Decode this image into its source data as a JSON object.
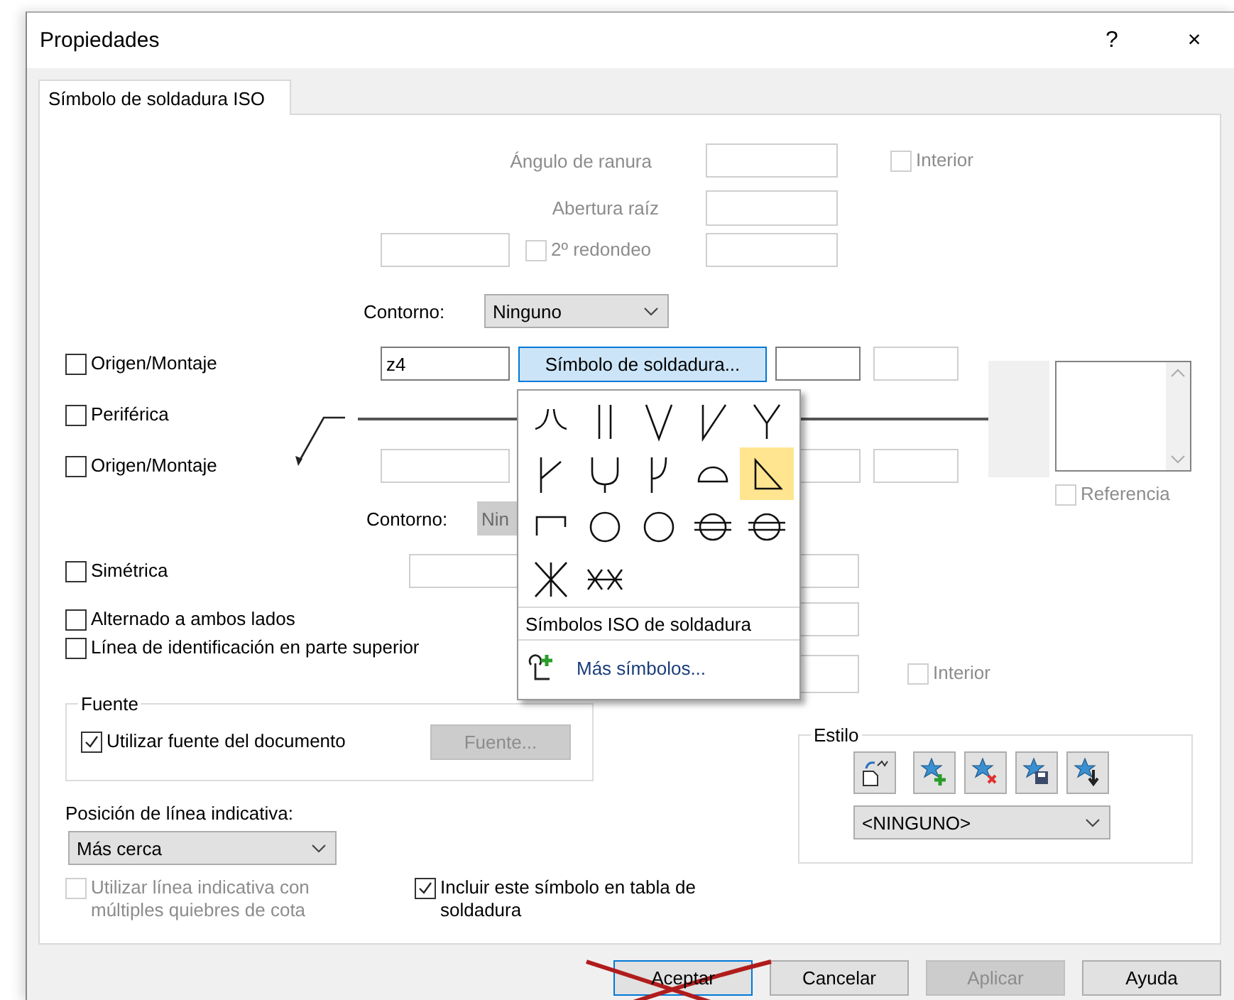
{
  "window": {
    "title": "Propiedades",
    "help": "?",
    "close": "×"
  },
  "tabs": [
    {
      "label": "Símbolo de soldadura ISO",
      "selected": true
    }
  ],
  "groove_angle": {
    "label": "Ángulo de ranura"
  },
  "root_opening": {
    "label": "Abertura raíz"
  },
  "inside_upper": {
    "label": "Interior",
    "checked": false,
    "disabled": true
  },
  "second_round": {
    "label": "2º redondeo",
    "checked": false,
    "disabled": true
  },
  "contour_upper": {
    "label": "Contorno:",
    "value": "Ninguno",
    "disabled": false
  },
  "origin_upper": {
    "label": "Origen/Montaje",
    "checked": false,
    "disabled": false
  },
  "size_value": "z4",
  "symbol_button": {
    "label": "Símbolo de soldadura...",
    "pressed": true
  },
  "all_around": {
    "label": "Periférica",
    "checked": false,
    "disabled": false
  },
  "origin_lower": {
    "label": "Origen/Montaje",
    "checked": false,
    "disabled": false
  },
  "contour_lower": {
    "label": "Contorno:",
    "value": "Nin",
    "disabled": true
  },
  "reference": {
    "label": "Referencia",
    "checked": false,
    "disabled": true
  },
  "options": [
    {
      "label": "Simétrica",
      "checked": false,
      "disabled": false
    },
    {
      "label": "Alternado a ambos lados",
      "checked": false,
      "disabled": false
    },
    {
      "label": "Línea de identificación en parte superior",
      "checked": false,
      "disabled": false
    }
  ],
  "inside_lower": {
    "label": "Interior",
    "checked": false,
    "disabled": true
  },
  "font_group": {
    "title": "Fuente",
    "use_document_font": {
      "label": "Utilizar fuente del documento",
      "checked": true,
      "disabled": false
    },
    "font_button": {
      "label": "Fuente...",
      "disabled": true
    }
  },
  "leader_position": {
    "label": "Posición de línea indicativa:",
    "value": "Más cerca"
  },
  "multi_jog": {
    "label": "Utilizar línea indicativa con múltiples quiebres de cota",
    "checked": false,
    "disabled": true
  },
  "include_in_table": {
    "label": "Incluir este símbolo en tabla de soldadura",
    "checked": true,
    "disabled": false
  },
  "style_group": {
    "title": "Estilo",
    "value": "<NINGUNO>"
  },
  "symbol_menu": {
    "symbols": [
      {
        "selected": false
      },
      {
        "selected": false
      },
      {
        "selected": false
      },
      {
        "selected": false
      },
      {
        "selected": false
      },
      {
        "selected": false
      },
      {
        "selected": false
      },
      {
        "selected": false
      },
      {
        "selected": false
      },
      {
        "selected": true
      },
      {
        "selected": false
      },
      {
        "selected": false
      },
      {
        "selected": false
      },
      {
        "selected": false
      },
      {
        "selected": false
      },
      {
        "selected": false
      },
      {
        "selected": false
      }
    ],
    "section_title": "Símbolos ISO de soldadura",
    "more": "Más símbolos..."
  },
  "buttons": [
    {
      "label": "Aceptar",
      "disabled": false,
      "default": true,
      "crossed_out": true
    },
    {
      "label": "Cancelar",
      "disabled": false,
      "default": false,
      "crossed_out": false
    },
    {
      "label": "Aplicar",
      "disabled": true,
      "default": false,
      "crossed_out": false
    },
    {
      "label": "Ayuda",
      "disabled": false,
      "default": false,
      "crossed_out": false
    }
  ]
}
